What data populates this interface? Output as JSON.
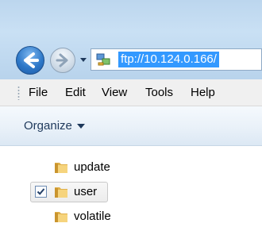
{
  "address": {
    "url": "ftp://10.124.0.166/",
    "icon": "network-location-icon"
  },
  "menu": {
    "items": [
      "File",
      "Edit",
      "View",
      "Tools",
      "Help"
    ]
  },
  "toolbar": {
    "organize_label": "Organize"
  },
  "tree": {
    "items": [
      {
        "label": "update",
        "checked": false,
        "selected": false
      },
      {
        "label": "user",
        "checked": true,
        "selected": true
      },
      {
        "label": "volatile",
        "checked": false,
        "selected": false
      }
    ]
  },
  "colors": {
    "selection": "#3399ff",
    "folder": "#f1c35a"
  }
}
